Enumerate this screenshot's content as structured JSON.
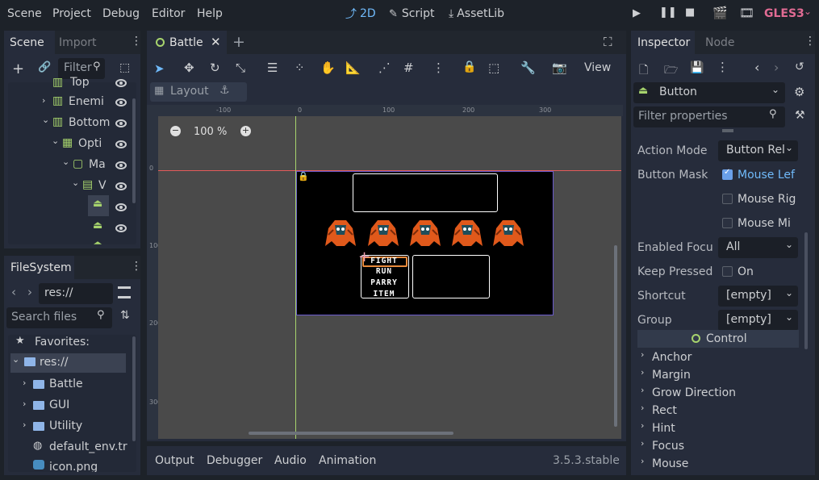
{
  "menubar": {
    "items": [
      "Scene",
      "Project",
      "Debug",
      "Editor",
      "Help"
    ],
    "workspaces": [
      "2D",
      "Script",
      "AssetLib"
    ],
    "renderer": "GLES3"
  },
  "scene_dock": {
    "tabs": [
      "Scene",
      "Import"
    ],
    "filter_placeholder": "Filter",
    "tree": [
      {
        "label": "Top"
      },
      {
        "label": "Enemi"
      },
      {
        "label": "Bottom"
      },
      {
        "label": "Opti"
      },
      {
        "label": "Ma"
      },
      {
        "label": "V"
      }
    ]
  },
  "filesystem": {
    "tab": "FileSystem",
    "path": "res://",
    "search_placeholder": "Search files",
    "favorites_label": "Favorites:",
    "items": [
      {
        "label": "res://"
      },
      {
        "label": "Battle"
      },
      {
        "label": "GUI"
      },
      {
        "label": "Utility"
      },
      {
        "label": "default_env.tr"
      },
      {
        "label": "icon.png"
      }
    ]
  },
  "editor": {
    "scene_tab": "Battle",
    "view_label": "View",
    "layout_label": "Layout",
    "zoom": "100 %",
    "ruler_h": [
      "-100",
      "0",
      "100",
      "200",
      "300"
    ],
    "ruler_v": [
      "0",
      "100",
      "200",
      "300"
    ]
  },
  "game": {
    "menu_items": [
      "FIGHT",
      "RUN",
      "PARRY",
      "ITEM"
    ],
    "enemy_count": 5
  },
  "bottom_panel": {
    "tabs": [
      "Output",
      "Debugger",
      "Audio",
      "Animation"
    ],
    "version": "3.5.3.stable"
  },
  "inspector": {
    "tabs": [
      "Inspector",
      "Node"
    ],
    "node_type": "Button",
    "filter_placeholder": "Filter properties",
    "properties": {
      "action_mode": {
        "label": "Action Mode",
        "value": "Button Rel"
      },
      "button_mask": {
        "label": "Button Mask",
        "options": [
          "Mouse Lef",
          "Mouse Rig",
          "Mouse Mi"
        ],
        "checked": [
          true,
          false,
          false
        ]
      },
      "enabled_focus": {
        "label": "Enabled Focu",
        "value": "All"
      },
      "keep_pressed": {
        "label": "Keep Pressed",
        "value": "On"
      },
      "shortcut": {
        "label": "Shortcut",
        "value": "[empty]"
      },
      "group": {
        "label": "Group",
        "value": "[empty]"
      }
    },
    "category": "Control",
    "sections": [
      "Anchor",
      "Margin",
      "Grow Direction",
      "Rect",
      "Hint",
      "Focus",
      "Mouse"
    ]
  },
  "colors": {
    "accent": "#70bafa",
    "renderer": "#e16b93",
    "enemy": "#e0591b",
    "guide_red": "#e35a5a",
    "guide_green": "#a7d46d"
  }
}
